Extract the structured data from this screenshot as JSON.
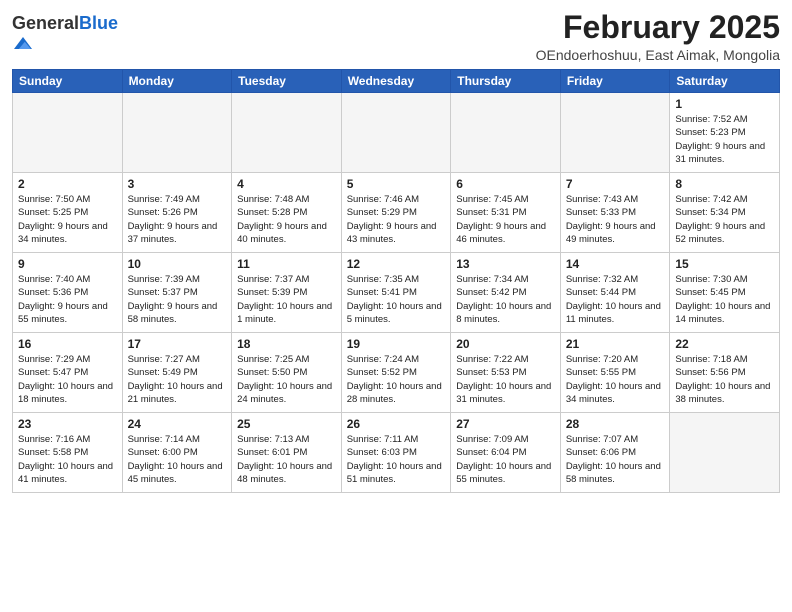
{
  "logo": {
    "general": "General",
    "blue": "Blue"
  },
  "header": {
    "month": "February 2025",
    "location": "OEndoerhoshuu, East Aimak, Mongolia"
  },
  "weekdays": [
    "Sunday",
    "Monday",
    "Tuesday",
    "Wednesday",
    "Thursday",
    "Friday",
    "Saturday"
  ],
  "weeks": [
    [
      {
        "day": "",
        "detail": ""
      },
      {
        "day": "",
        "detail": ""
      },
      {
        "day": "",
        "detail": ""
      },
      {
        "day": "",
        "detail": ""
      },
      {
        "day": "",
        "detail": ""
      },
      {
        "day": "",
        "detail": ""
      },
      {
        "day": "1",
        "detail": "Sunrise: 7:52 AM\nSunset: 5:23 PM\nDaylight: 9 hours and 31 minutes."
      }
    ],
    [
      {
        "day": "2",
        "detail": "Sunrise: 7:50 AM\nSunset: 5:25 PM\nDaylight: 9 hours and 34 minutes."
      },
      {
        "day": "3",
        "detail": "Sunrise: 7:49 AM\nSunset: 5:26 PM\nDaylight: 9 hours and 37 minutes."
      },
      {
        "day": "4",
        "detail": "Sunrise: 7:48 AM\nSunset: 5:28 PM\nDaylight: 9 hours and 40 minutes."
      },
      {
        "day": "5",
        "detail": "Sunrise: 7:46 AM\nSunset: 5:29 PM\nDaylight: 9 hours and 43 minutes."
      },
      {
        "day": "6",
        "detail": "Sunrise: 7:45 AM\nSunset: 5:31 PM\nDaylight: 9 hours and 46 minutes."
      },
      {
        "day": "7",
        "detail": "Sunrise: 7:43 AM\nSunset: 5:33 PM\nDaylight: 9 hours and 49 minutes."
      },
      {
        "day": "8",
        "detail": "Sunrise: 7:42 AM\nSunset: 5:34 PM\nDaylight: 9 hours and 52 minutes."
      }
    ],
    [
      {
        "day": "9",
        "detail": "Sunrise: 7:40 AM\nSunset: 5:36 PM\nDaylight: 9 hours and 55 minutes."
      },
      {
        "day": "10",
        "detail": "Sunrise: 7:39 AM\nSunset: 5:37 PM\nDaylight: 9 hours and 58 minutes."
      },
      {
        "day": "11",
        "detail": "Sunrise: 7:37 AM\nSunset: 5:39 PM\nDaylight: 10 hours and 1 minute."
      },
      {
        "day": "12",
        "detail": "Sunrise: 7:35 AM\nSunset: 5:41 PM\nDaylight: 10 hours and 5 minutes."
      },
      {
        "day": "13",
        "detail": "Sunrise: 7:34 AM\nSunset: 5:42 PM\nDaylight: 10 hours and 8 minutes."
      },
      {
        "day": "14",
        "detail": "Sunrise: 7:32 AM\nSunset: 5:44 PM\nDaylight: 10 hours and 11 minutes."
      },
      {
        "day": "15",
        "detail": "Sunrise: 7:30 AM\nSunset: 5:45 PM\nDaylight: 10 hours and 14 minutes."
      }
    ],
    [
      {
        "day": "16",
        "detail": "Sunrise: 7:29 AM\nSunset: 5:47 PM\nDaylight: 10 hours and 18 minutes."
      },
      {
        "day": "17",
        "detail": "Sunrise: 7:27 AM\nSunset: 5:49 PM\nDaylight: 10 hours and 21 minutes."
      },
      {
        "day": "18",
        "detail": "Sunrise: 7:25 AM\nSunset: 5:50 PM\nDaylight: 10 hours and 24 minutes."
      },
      {
        "day": "19",
        "detail": "Sunrise: 7:24 AM\nSunset: 5:52 PM\nDaylight: 10 hours and 28 minutes."
      },
      {
        "day": "20",
        "detail": "Sunrise: 7:22 AM\nSunset: 5:53 PM\nDaylight: 10 hours and 31 minutes."
      },
      {
        "day": "21",
        "detail": "Sunrise: 7:20 AM\nSunset: 5:55 PM\nDaylight: 10 hours and 34 minutes."
      },
      {
        "day": "22",
        "detail": "Sunrise: 7:18 AM\nSunset: 5:56 PM\nDaylight: 10 hours and 38 minutes."
      }
    ],
    [
      {
        "day": "23",
        "detail": "Sunrise: 7:16 AM\nSunset: 5:58 PM\nDaylight: 10 hours and 41 minutes."
      },
      {
        "day": "24",
        "detail": "Sunrise: 7:14 AM\nSunset: 6:00 PM\nDaylight: 10 hours and 45 minutes."
      },
      {
        "day": "25",
        "detail": "Sunrise: 7:13 AM\nSunset: 6:01 PM\nDaylight: 10 hours and 48 minutes."
      },
      {
        "day": "26",
        "detail": "Sunrise: 7:11 AM\nSunset: 6:03 PM\nDaylight: 10 hours and 51 minutes."
      },
      {
        "day": "27",
        "detail": "Sunrise: 7:09 AM\nSunset: 6:04 PM\nDaylight: 10 hours and 55 minutes."
      },
      {
        "day": "28",
        "detail": "Sunrise: 7:07 AM\nSunset: 6:06 PM\nDaylight: 10 hours and 58 minutes."
      },
      {
        "day": "",
        "detail": ""
      }
    ]
  ]
}
